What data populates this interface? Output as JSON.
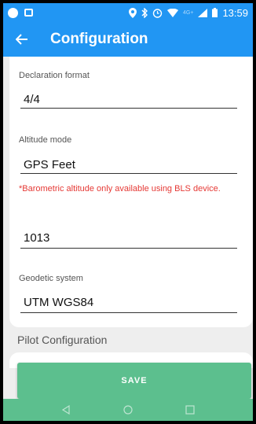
{
  "status_bar": {
    "time": "13:59",
    "network": "4G+"
  },
  "app_bar": {
    "title": "Configuration",
    "back_icon": "arrow-back-icon"
  },
  "form": {
    "declaration_format": {
      "label": "Declaration format",
      "value": "4/4"
    },
    "altitude_mode": {
      "label": "Altitude mode",
      "value": "GPS Feet",
      "warning": "*Barometric altitude only available using BLS device."
    },
    "pressure": {
      "value": "1013"
    },
    "geodetic_system": {
      "label": "Geodetic system",
      "value": "UTM WGS84"
    }
  },
  "pilot_section": {
    "title": "Pilot Configuration"
  },
  "save_button": {
    "label": "SAVE"
  },
  "colors": {
    "primary": "#2196f3",
    "accent": "#5cbf8e",
    "warning": "#e53935"
  }
}
